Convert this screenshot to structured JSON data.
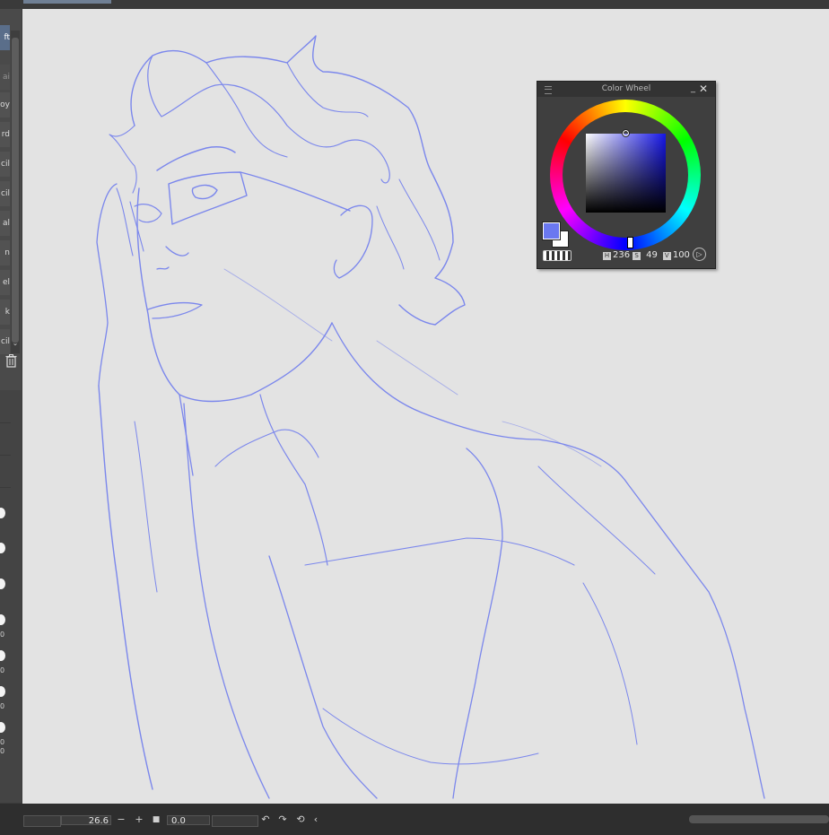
{
  "left_panel": {
    "subtools": [
      {
        "label": "ft",
        "selected": true
      },
      {
        "label": "ai",
        "selected": false
      },
      {
        "label": "oy",
        "selected": false
      },
      {
        "label": "rd",
        "selected": false
      },
      {
        "label": "cil",
        "selected": false
      },
      {
        "label": "cil",
        "selected": false
      },
      {
        "label": "al",
        "selected": false
      },
      {
        "label": "n",
        "selected": false
      },
      {
        "label": "el",
        "selected": false
      },
      {
        "label": "k",
        "selected": false
      },
      {
        "label": "cil",
        "selected": false
      }
    ],
    "trash_icon": "trash-icon",
    "brush_size_digits": [
      "0",
      "0",
      "0",
      "0",
      "0"
    ]
  },
  "color_wheel": {
    "title": "Color Wheel",
    "hue": "236",
    "saturation": "49",
    "value": "100",
    "hue_tag": "H",
    "sat_tag": "S",
    "val_tag": "V",
    "main_color": "#6a78f0",
    "sub_color": "#ffffff"
  },
  "bottom_bar": {
    "zoom_value": "26.6",
    "zoom_out_label": "−",
    "zoom_in_label": "+",
    "fit_label": "■",
    "rotation_value": "0.0",
    "rotate_left_label": "↶",
    "rotate_right_label": "↷",
    "reset_rotation_label": "⟲",
    "collapse_label": "‹"
  },
  "canvas": {
    "line_color": "#7b87ec",
    "paper_color": "#e3e3e3"
  }
}
